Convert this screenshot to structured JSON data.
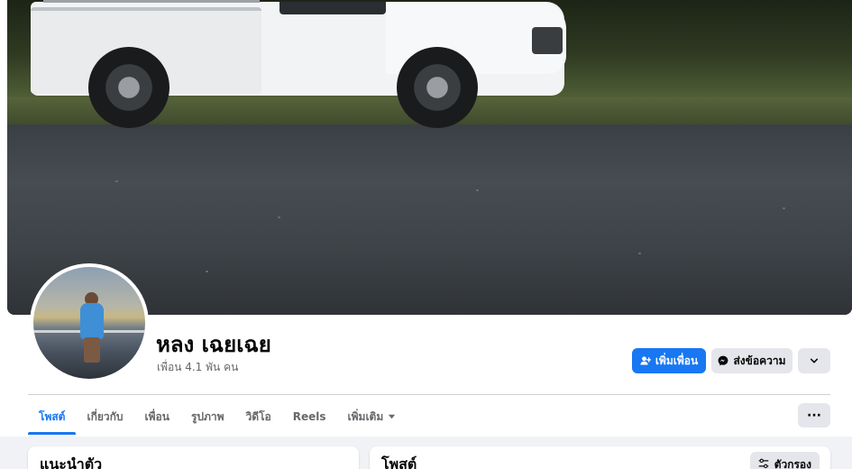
{
  "profile": {
    "name": "หลง เฉยเฉย",
    "friends_count": "เพื่อน 4.1 พัน คน"
  },
  "actions": {
    "add_friend_label": "เพิ่มเพื่อน",
    "message_label": "ส่งข้อความ",
    "add_friend_icon": "add-person-icon",
    "message_icon": "messenger-icon",
    "more_icon": "chevron-down-icon"
  },
  "tabs": [
    {
      "label": "โพสต์",
      "active": true
    },
    {
      "label": "เกี่ยวกับ"
    },
    {
      "label": "เพื่อน"
    },
    {
      "label": "รูปภาพ"
    },
    {
      "label": "วิดีโอ"
    },
    {
      "label": "Reels"
    },
    {
      "label": "เพิ่มเติม"
    }
  ],
  "tabs_more_label": "···",
  "intro_card": {
    "title": "แนะนำตัว"
  },
  "posts_card": {
    "title": "โพสต์",
    "filter_label": "ตัวกรอง"
  },
  "colors": {
    "accent": "#1877f2",
    "secondary_button": "#e4e6eb",
    "page_background": "#f0f2f5"
  }
}
